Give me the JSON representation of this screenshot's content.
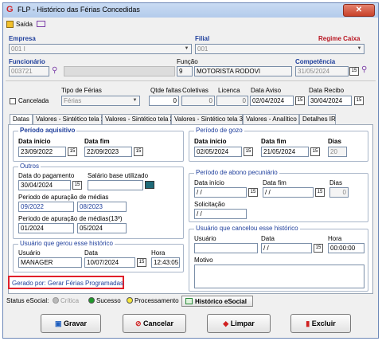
{
  "window": {
    "title": "FLP - Histórico das Férias Concedidas",
    "close": "✕"
  },
  "toolbar": {
    "exit_label": "Saída"
  },
  "header": {
    "empresa_label": "Empresa",
    "empresa_value": "001 I",
    "filial_label": "Filial",
    "filial_value": "001",
    "regime_label": "Regime Caixa",
    "funcionario_label": "Funcionário",
    "funcionario_code": "003721",
    "funcao_label": "Função",
    "funcao_code": "9",
    "funcao_name": "MOTORISTA RODOVI",
    "competencia_label": "Competência",
    "competencia_value": "31/05/2024"
  },
  "row2": {
    "cancelada_label": "Cancelada",
    "tipo_label": "Tipo de Férias",
    "tipo_value": "Férias",
    "qtde_label": "Qtde faltas",
    "qtde_value": "0",
    "coletivas_label": "Coletivas",
    "coletivas_value": "0",
    "licenca_label": "Licenca",
    "licenca_value": "0",
    "aviso_label": "Data Aviso",
    "aviso_value": "02/04/2024",
    "recibo_label": "Data Recibo",
    "recibo_value": "30/04/2024"
  },
  "tabs": [
    "Datas",
    "Valores - Sintético tela 1",
    "Valores - Sintético tela 2",
    "Valores - Sintético tela 3",
    "Valores - Analítico",
    "Detalhes IR"
  ],
  "aquisitivo": {
    "title": "Período aquisitivo",
    "inicio_label": "Data início",
    "inicio_value": "23/09/2022",
    "fim_label": "Data fim",
    "fim_value": "22/09/2023"
  },
  "outros": {
    "title": "Outros",
    "pagamento_label": "Data do pagamento",
    "pagamento_value": "30/04/2024",
    "salario_label": "Salário base utilizado",
    "apuracao_label": "Periodo de apuração de médias",
    "apuracao_from": "09/2022",
    "apuracao_to": "08/2023",
    "apuracao13_label": "Periodo de apuração de médias(13º)",
    "apuracao13_from": "01/2024",
    "apuracao13_to": "05/2024"
  },
  "gerou": {
    "title": "Usuário que gerou esse histórico",
    "usuario_label": "Usuário",
    "usuario_value": "MANAGER",
    "data_label": "Data",
    "data_value": "10/07/2024",
    "hora_label": "Hora",
    "hora_value": "12:43:05"
  },
  "gerado_por": "Gerado por: Gerar Férias Programadas",
  "gozo": {
    "title": "Período de gozo",
    "inicio_label": "Data início",
    "inicio_value": "02/05/2024",
    "fim_label": "Data fim",
    "fim_value": "21/05/2024",
    "dias_label": "Dias",
    "dias_value": "20"
  },
  "abono": {
    "title": "Período de abono pecuniário",
    "inicio_label": "Data início",
    "inicio_value": " / /",
    "fim_label": "Data fim",
    "fim_value": " / /",
    "dias_label": "Dias",
    "dias_value": "0",
    "solic_label": "Solicitação",
    "solic_value": " / /"
  },
  "cancelou": {
    "title": "Usuário que cancelou esse histórico",
    "usuario_label": "Usuário",
    "data_label": "Data",
    "data_value": " / /",
    "hora_label": "Hora",
    "hora_value": "00:00:00",
    "motivo_label": "Motivo"
  },
  "esocial": {
    "status_label": "Status eSocial:",
    "critica": "Crítica",
    "sucesso": "Sucesso",
    "processamento": "Processamento",
    "historico": "Histórico eSocial"
  },
  "buttons": {
    "gravar": "Gravar",
    "cancelar": "Cancelar",
    "limpar": "Limpar",
    "excluir": "Excluir"
  },
  "colors": {
    "accent_blue": "#1f3f9c",
    "regime_red": "#b81420",
    "gerado_border": "#e0202a"
  }
}
